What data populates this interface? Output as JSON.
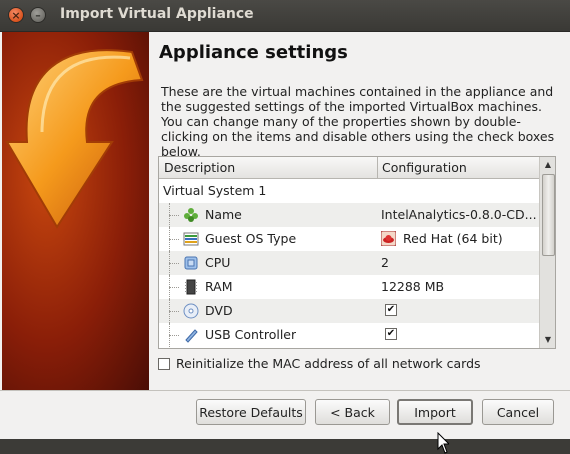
{
  "window": {
    "title": "Import Virtual Appliance"
  },
  "page": {
    "heading": "Appliance settings",
    "description": "These are the virtual machines contained in the appliance and the suggested settings of the imported VirtualBox machines. You can change many of the properties shown by double-clicking on the items and disable others using the check boxes below."
  },
  "table": {
    "columns": [
      "Description",
      "Configuration"
    ],
    "system": "Virtual System 1",
    "rows": [
      {
        "label": "Name",
        "value": "IntelAnalytics-0.8.0-CD...",
        "icon": "name-icon"
      },
      {
        "label": "Guest OS Type",
        "value": "Red Hat (64 bit)",
        "icon": "guest-os-icon"
      },
      {
        "label": "CPU",
        "value": "2",
        "icon": "cpu-icon"
      },
      {
        "label": "RAM",
        "value": "12288 MB",
        "icon": "ram-icon"
      },
      {
        "label": "DVD",
        "value": "",
        "checked": true,
        "icon": "dvd-icon"
      },
      {
        "label": "USB Controller",
        "value": "",
        "checked": true,
        "icon": "usb-icon"
      }
    ]
  },
  "options": {
    "reinit_mac_label": "Reinitialize the MAC address of all network cards",
    "reinit_mac_checked": false
  },
  "buttons": {
    "restore": "Restore Defaults",
    "back": "< Back",
    "import": "Import",
    "cancel": "Cancel"
  },
  "colors": {
    "banner": "#c8470f",
    "titlebar": "#3c3b37",
    "close_button": "#e0592a"
  }
}
